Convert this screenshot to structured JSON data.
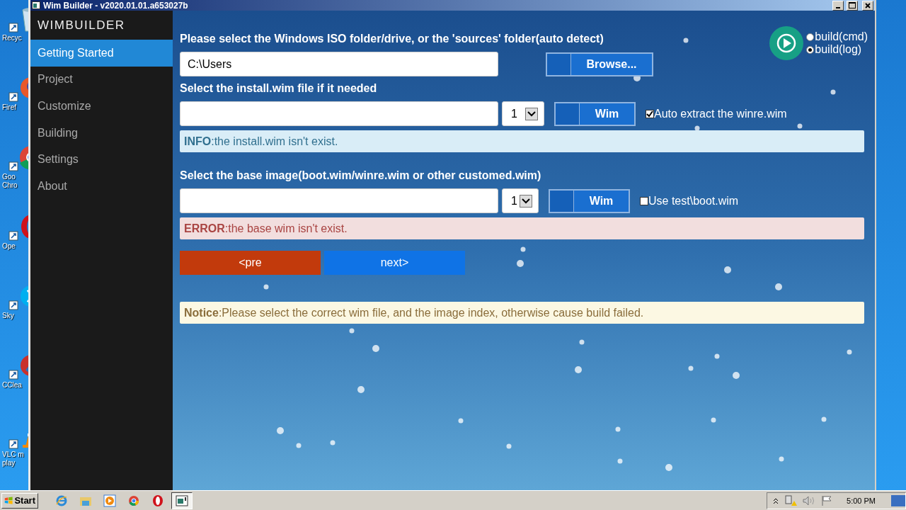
{
  "desktop_icons": [
    {
      "kind": "recycle",
      "lines": [
        "Recyc"
      ]
    },
    {
      "kind": "firefox",
      "lines": [
        "Firef"
      ]
    },
    {
      "kind": "chrome",
      "lines": [
        "Goo",
        "Chro"
      ]
    },
    {
      "kind": "opera",
      "lines": [
        "Ope"
      ]
    },
    {
      "kind": "skype",
      "lines": [
        "Sky"
      ]
    },
    {
      "kind": "ccleaner",
      "lines": [
        "CClea"
      ]
    },
    {
      "kind": "vlc",
      "lines": [
        "VLC m",
        "play"
      ]
    }
  ],
  "window": {
    "title": "Wim Builder - v2020.01.01.a653027b"
  },
  "sidebar": {
    "title": "WIMBUILDER",
    "items": [
      {
        "label": "Getting Started",
        "selected": true
      },
      {
        "label": "Project",
        "selected": false
      },
      {
        "label": "Customize",
        "selected": false
      },
      {
        "label": "Building",
        "selected": false
      },
      {
        "label": "Settings",
        "selected": false
      },
      {
        "label": "About",
        "selected": false
      }
    ]
  },
  "build_options": [
    {
      "label": "build(cmd)",
      "selected": false
    },
    {
      "label": "build(log)",
      "selected": true
    }
  ],
  "source": {
    "label": "Please select the Windows ISO folder/drive, or the 'sources' folder(auto detect)",
    "value": "C:\\Users",
    "button": "Browse..."
  },
  "wim_sections": [
    {
      "label": "Select the install.wim file if it needed",
      "index": "1",
      "button": "Wim",
      "option": {
        "label": "Auto extract the winre.wim",
        "checked": true
      },
      "alert": {
        "kind": "info",
        "text": "**INFO**:the install.wim isn't exist."
      }
    },
    {
      "label": "Select the base image(boot.wim/winre.wim or other customed.wim)",
      "index": "1",
      "button": "Wim",
      "option": {
        "label": "Use test\\boot.wim",
        "checked": false
      },
      "alert": {
        "kind": "error",
        "text": "**ERROR**:the base wim isn't exist."
      }
    }
  ],
  "nav_buttons": [
    {
      "kind": "prev",
      "label": "<pre"
    },
    {
      "kind": "next",
      "label": "next>"
    }
  ],
  "notice": {
    "kind": "notice",
    "text": "**Notice**:Please select the correct wim file, and the image index, otherwise cause build failed."
  },
  "taskbar": {
    "start": "Start",
    "apps": [
      {
        "kind": "ie",
        "selected": false
      },
      {
        "kind": "explorer",
        "selected": false
      },
      {
        "kind": "media",
        "selected": false
      },
      {
        "kind": "chrome",
        "selected": false
      },
      {
        "kind": "opera",
        "selected": false
      },
      {
        "kind": "app",
        "selected": true
      }
    ],
    "clock": "5:00 PM"
  }
}
